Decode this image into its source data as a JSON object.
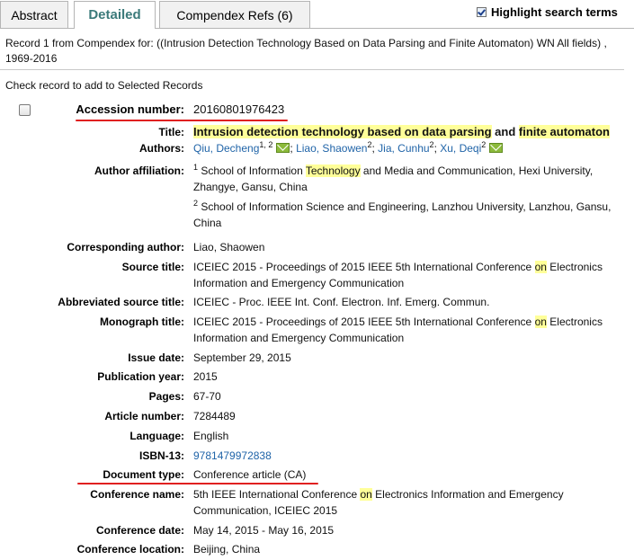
{
  "tabs": {
    "abstract": "Abstract",
    "detailed": "Detailed",
    "refs": "Compendex Refs (6)"
  },
  "highlight": {
    "label": "Highlight search terms",
    "checked": true
  },
  "record_info": "Record 1 from Compendex for: ((Intrusion Detection Technology Based on Data Parsing and Finite Automaton) WN All fields) , 1969-2016",
  "check_note": "Check record to add to Selected Records",
  "labels": {
    "accession": "Accession number:",
    "title": "Title:",
    "authors": "Authors:",
    "affiliation": "Author affiliation:",
    "corresponding": "Corresponding author:",
    "source": "Source title:",
    "abbrev": "Abbreviated source title:",
    "monograph": "Monograph title:",
    "issue": "Issue date:",
    "year": "Publication year:",
    "pages": "Pages:",
    "article": "Article number:",
    "language": "Language:",
    "isbn": "ISBN-13:",
    "doctype": "Document type:",
    "confname": "Conference name:",
    "confdate": "Conference date:",
    "conflocation": "Conference location:"
  },
  "record": {
    "accession": "20160801976423",
    "title": {
      "part1": "Intrusion detection technology based on data parsing",
      "and": " and ",
      "part2": "finite automaton"
    },
    "authors": [
      {
        "name": "Qiu, Decheng",
        "sup": "1, 2",
        "email": true
      },
      {
        "name": "Liao, Shaowen",
        "sup": "2",
        "email": false
      },
      {
        "name": "Jia, Cunhu",
        "sup": "2",
        "email": false
      },
      {
        "name": "Xu, Deqi",
        "sup": "2",
        "email": true
      }
    ],
    "affiliation1": {
      "sup": "1",
      "pre": " School of Information ",
      "hl": "Technology",
      "post": " and Media and Communication, Hexi University, Zhangye, Gansu, China"
    },
    "affiliation2": {
      "sup": "2",
      "text": " School of Information Science and Engineering, Lanzhou University, Lanzhou, Gansu, China"
    },
    "corresponding": "Liao, Shaowen",
    "source": {
      "pre": "ICEIEC 2015 - Proceedings of 2015 IEEE 5th International Conference ",
      "hl": "on",
      "post": " Electronics Information and Emergency Communication"
    },
    "abbrev": "ICEIEC - Proc. IEEE Int. Conf. Electron. Inf. Emerg. Commun.",
    "monograph": {
      "pre": "ICEIEC 2015 - Proceedings of 2015 IEEE 5th International Conference ",
      "hl": "on",
      "post": " Electronics Information and Emergency Communication"
    },
    "issue": "September 29, 2015",
    "year": "2015",
    "pages": "67-70",
    "article": "7284489",
    "language": "English",
    "isbn": "9781479972838",
    "doctype": "Conference article (CA)",
    "confname": {
      "pre": "5th IEEE International Conference ",
      "hl": "on",
      "post": " Electronics Information and Emergency Communication, ICEIEC 2015"
    },
    "confdate": "May 14, 2015 - May 16, 2015",
    "conflocation": "Beijing, China"
  },
  "colors": {
    "link": "#2064a8",
    "highlight": "#ffff99",
    "annotation": "#e02020",
    "tab_active": "#3b7a7a"
  }
}
